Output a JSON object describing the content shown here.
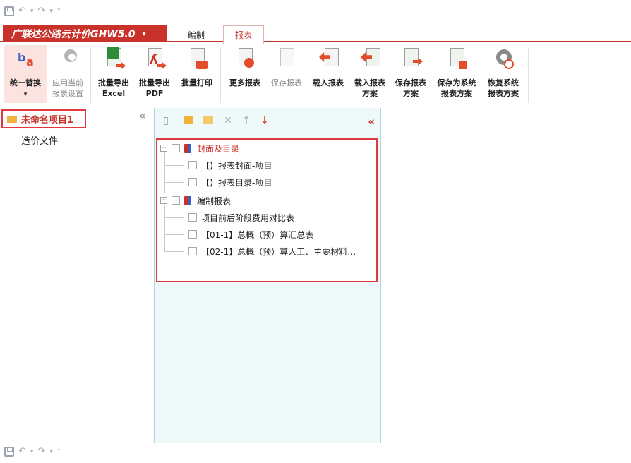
{
  "quick_access": {
    "undo_caret": "▾",
    "redo_caret": "▾",
    "more": "⁼"
  },
  "app_menu": {
    "label": "广联达公路云计价GHW5.0",
    "caret": "▾"
  },
  "tabs": [
    {
      "label": "编制",
      "active": false
    },
    {
      "label": "报表",
      "active": true
    }
  ],
  "ribbon": [
    {
      "id": "unify-replace",
      "label": [
        "统一替换",
        "▾"
      ],
      "icon": "letters-ba-icon",
      "disabled": false
    },
    {
      "id": "apply-settings",
      "label": [
        "应用当前",
        "报表设置"
      ],
      "icon": "settings-hand-icon",
      "disabled": true
    },
    {
      "id": "export-excel",
      "label": [
        "批量导出",
        "Excel"
      ],
      "icon": "excel-export-icon",
      "disabled": false
    },
    {
      "id": "export-pdf",
      "label": [
        "批量导出",
        "PDF"
      ],
      "icon": "pdf-export-icon",
      "disabled": false
    },
    {
      "id": "batch-print",
      "label": [
        "批量打印",
        ""
      ],
      "icon": "print-icon",
      "disabled": false
    },
    {
      "id": "more-reports",
      "label": [
        "更多报表",
        ""
      ],
      "icon": "more-reports-icon",
      "disabled": false
    },
    {
      "id": "save-report",
      "label": [
        "保存报表",
        ""
      ],
      "icon": "save-report-icon",
      "disabled": true
    },
    {
      "id": "load-report",
      "label": [
        "载入报表",
        ""
      ],
      "icon": "load-report-icon",
      "disabled": false
    },
    {
      "id": "load-scheme",
      "label": [
        "载入报表",
        "方案"
      ],
      "icon": "load-scheme-icon",
      "disabled": false
    },
    {
      "id": "save-scheme",
      "label": [
        "保存报表",
        "方案"
      ],
      "icon": "save-scheme-icon",
      "disabled": false
    },
    {
      "id": "save-system-scheme",
      "label": [
        "保存为系统",
        "报表方案"
      ],
      "icon": "save-system-scheme-icon",
      "disabled": false
    },
    {
      "id": "restore-system-scheme",
      "label": [
        "恢复系统",
        "报表方案"
      ],
      "icon": "restore-system-scheme-icon",
      "disabled": false
    }
  ],
  "project_panel": {
    "project_name": "未命名项目1",
    "cost_file": "造价文件",
    "collapse_glyph": "«"
  },
  "tree_toolbar": {
    "collapse_glyph": "«",
    "delete_glyph": "✕",
    "up_glyph": "↑",
    "down_glyph": "↓"
  },
  "tree": {
    "groups": [
      {
        "label": "封面及目录",
        "expand": "−",
        "children": [
          "【】报表封面-项目",
          "【】报表目录-项目"
        ]
      },
      {
        "label": "编制报表",
        "expand": "−",
        "children": [
          "项目前后阶段费用对比表",
          "【01-1】总概（预）算汇总表",
          "【02-1】总概（预）算人工、主要材料…"
        ]
      }
    ]
  },
  "colors": {
    "accent": "#c8322a",
    "highlight_border": "#e0393e",
    "panel_bg": "#eefafa"
  }
}
